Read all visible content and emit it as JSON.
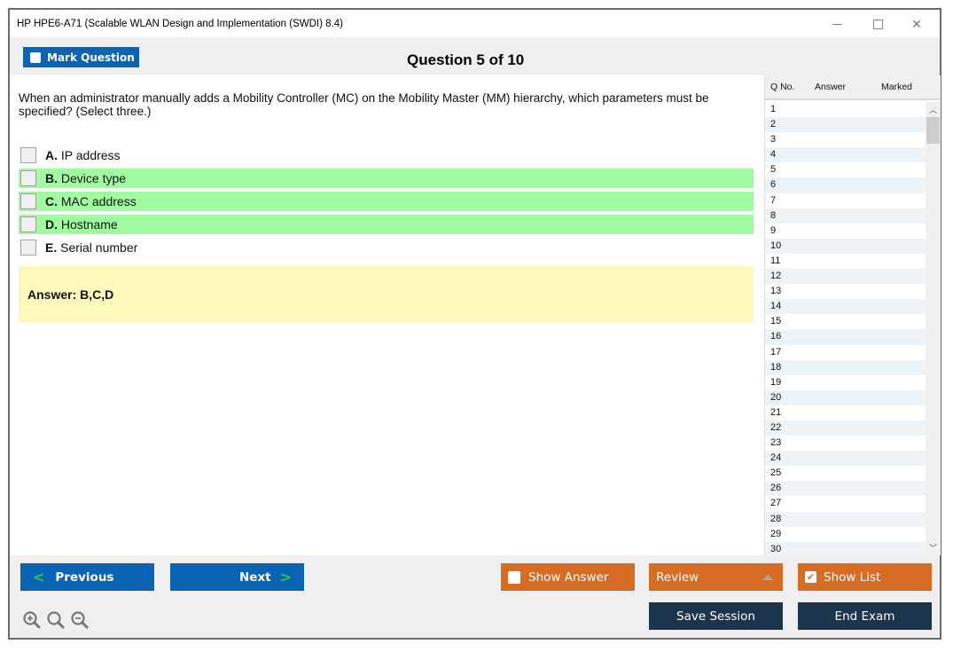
{
  "window": {
    "title": "HP HPE6-A71 (Scalable WLAN Design and Implementation (SWDI) 8.4)",
    "controls": {
      "minimize": "minimize",
      "maximize": "maximize",
      "close": "close"
    }
  },
  "header": {
    "mark_question_label": "Mark Question",
    "mark_question_checked": false,
    "question_counter": "Question 5 of 10"
  },
  "question": {
    "text": "When an administrator manually adds a Mobility Controller (MC) on the Mobility Master (MM) hierarchy, which parameters must be specified? (Select three.)",
    "options": [
      {
        "letter": "A.",
        "text": " IP address",
        "correct": false,
        "checked": false
      },
      {
        "letter": "B.",
        "text": " Device type",
        "correct": true,
        "checked": false
      },
      {
        "letter": "C.",
        "text": " MAC address",
        "correct": true,
        "checked": false
      },
      {
        "letter": "D.",
        "text": " Hostname",
        "correct": true,
        "checked": false
      },
      {
        "letter": "E.",
        "text": " Serial number",
        "correct": false,
        "checked": false
      }
    ],
    "answer_text": "Answer: B,C,D",
    "highlight_color": "#a1fca1",
    "answer_bg_color": "#fef9bb"
  },
  "question_list": {
    "headers": {
      "qno": "Q No.",
      "answer": "Answer",
      "marked": "Marked"
    },
    "rows": [
      "1",
      "2",
      "3",
      "4",
      "5",
      "6",
      "7",
      "8",
      "9",
      "10",
      "11",
      "12",
      "13",
      "14",
      "15",
      "16",
      "17",
      "18",
      "19",
      "20",
      "21",
      "22",
      "23",
      "24",
      "25",
      "26",
      "27",
      "28",
      "29",
      "30"
    ]
  },
  "footer": {
    "previous_label": "Previous",
    "next_label": "Next",
    "show_answer_label": "Show Answer",
    "show_answer_checked": false,
    "review_label": "Review",
    "show_list_label": "Show List",
    "show_list_checked": true,
    "save_session_label": "Save Session",
    "end_exam_label": "End Exam",
    "zoom_icons": [
      "zoom-in-icon",
      "zoom-reset-icon",
      "zoom-out-icon"
    ]
  },
  "colors": {
    "primary_blue": "#0b64b3",
    "accent_orange": "#d76d24",
    "navy": "#1c354d",
    "chevron_green": "#34c44a"
  }
}
